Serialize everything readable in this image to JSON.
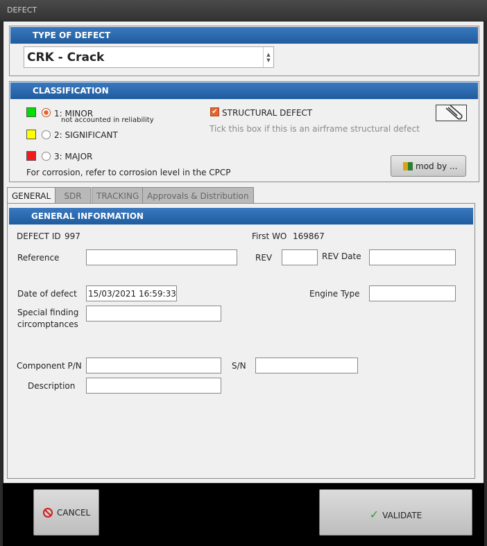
{
  "window": {
    "title": "DEFECT"
  },
  "type_of_defect": {
    "header": "TYPE OF DEFECT",
    "selected": "CRK - Crack"
  },
  "classification": {
    "header": "CLASSIFICATION",
    "options": [
      {
        "label": "1: MINOR",
        "sublabel": "not accounted in reliability",
        "color": "#00e000",
        "selected": true
      },
      {
        "label": "2: SIGNIFICANT",
        "color": "#ffff00",
        "selected": false
      },
      {
        "label": "3: MAJOR",
        "color": "#ee1c1c",
        "selected": false
      }
    ],
    "corrosion_note": "For corrosion, refer to corrosion level in the CPCP",
    "structural": {
      "label": "STRUCTURAL DEFECT",
      "checked": true,
      "hint": "Tick this box if this is an airframe structural defect"
    },
    "attach_icon": "paperclip-icon",
    "mod_button": "mod by ..."
  },
  "tabs": [
    {
      "label": "GENERAL",
      "active": true
    },
    {
      "label": "SDR",
      "active": false
    },
    {
      "label": "TRACKING",
      "active": false
    },
    {
      "label": "Approvals & Distribution",
      "active": false
    }
  ],
  "general": {
    "header": "GENERAL INFORMATION",
    "defect_id_label": "DEFECT ID",
    "defect_id_value": "997",
    "first_wo_label": "First WO",
    "first_wo_value": "169867",
    "reference_label": "Reference",
    "reference_value": "",
    "rev_label": "REV",
    "rev_value": "",
    "rev_date_label": "REV Date",
    "rev_date_value": "",
    "date_label": "Date of defect",
    "date_value": "15/03/2021 16:59:33",
    "engine_type_label": "Engine Type",
    "engine_type_value": "",
    "special_label_1": "Special finding",
    "special_label_2": "circomptances",
    "special_value": "",
    "component_pn_label": "Component P/N",
    "component_pn_value": "",
    "sn_label": "S/N",
    "sn_value": "",
    "description_label": "Description",
    "description_value": ""
  },
  "footer": {
    "cancel_label": "CANCEL",
    "validate_label": "VALIDATE"
  }
}
